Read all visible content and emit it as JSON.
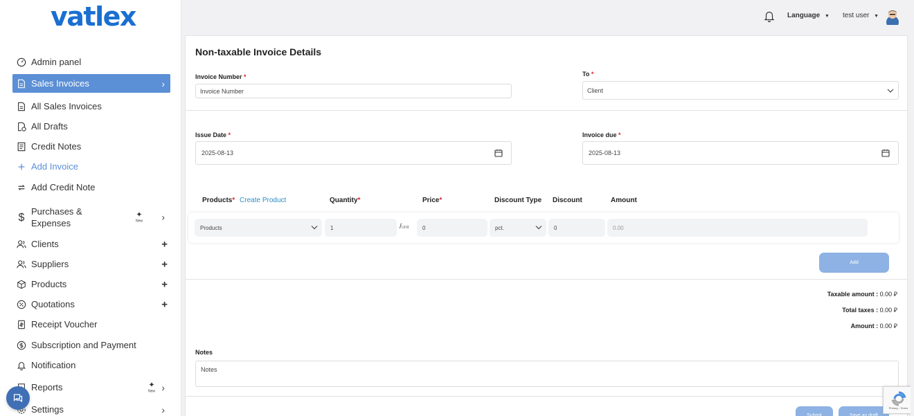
{
  "brand": {
    "logo": "vatlex"
  },
  "sidebar": {
    "items": [
      {
        "label": "Admin panel",
        "icon": "gauge-icon"
      },
      {
        "label": "Sales Invoices",
        "icon": "document-icon",
        "active": true
      },
      {
        "label": "All Sales Invoices",
        "icon": "document-icon"
      },
      {
        "label": "All Drafts",
        "icon": "draft-icon"
      },
      {
        "label": "Credit Notes",
        "icon": "note-icon"
      },
      {
        "label": "Add Invoice",
        "icon": "plus-icon"
      },
      {
        "label": "Add Credit Note",
        "icon": "repeat-icon"
      },
      {
        "label": "Purchases & Expenses",
        "icon": "dollar-icon",
        "badge": "New"
      },
      {
        "label": "Clients",
        "icon": "users-icon"
      },
      {
        "label": "Suppliers",
        "icon": "users-icon"
      },
      {
        "label": "Products",
        "icon": "box-icon"
      },
      {
        "label": "Quotations",
        "icon": "percent-icon"
      },
      {
        "label": "Receipt Voucher",
        "icon": "receipt-icon"
      },
      {
        "label": "Subscription and Payment",
        "icon": "dollar-circle-icon"
      },
      {
        "label": "Notification",
        "icon": "bell-icon"
      },
      {
        "label": "Reports",
        "icon": "report-icon",
        "badge": "New"
      },
      {
        "label": "Settings",
        "icon": "gear-icon"
      }
    ]
  },
  "topbar": {
    "language": "Language",
    "user": "test user"
  },
  "form": {
    "title": "Non-taxable Invoice Details",
    "invoice_number_label": "Invoice Number",
    "invoice_number_placeholder": "Invoice Number",
    "to_label": "To",
    "to_placeholder": "Client",
    "issue_date_label": "Issue Date",
    "issue_date_value": "2025-08-13",
    "invoice_due_label": "Invoice due",
    "invoice_due_value": "2025-08-13"
  },
  "products_table": {
    "headers": {
      "products": "Products",
      "create_product": "Create Product",
      "quantity": "Quantity",
      "price": "Price",
      "discount_type": "Discount Type",
      "discount": "Discount",
      "amount": "Amount"
    },
    "row": {
      "product_placeholder": "Products",
      "quantity": "1",
      "unit_sep": "/",
      "unit": "Unit",
      "price": "0",
      "discount_type": "pct.",
      "discount": "0",
      "amount": "0.00"
    },
    "add_label": "Add"
  },
  "totals": {
    "taxable_label": "Taxable amount :",
    "taxable_value": "0.00",
    "taxes_label": "Total taxes :",
    "taxes_value": "0.00",
    "amount_label": "Amount :",
    "amount_value": "0.00",
    "currency_symbol": "⃁"
  },
  "notes": {
    "label": "Notes",
    "placeholder": "Notes"
  },
  "actions": {
    "submit": "Submit",
    "save_draft": "Save as draft"
  },
  "recaptcha": {
    "text": "Privacy - Terms"
  },
  "colors": {
    "primary": "#1a6fd1",
    "active_nav": "#5b8fd6",
    "button": "#8db2e3",
    "required": "#dd2222",
    "link": "#2a8ec7"
  }
}
